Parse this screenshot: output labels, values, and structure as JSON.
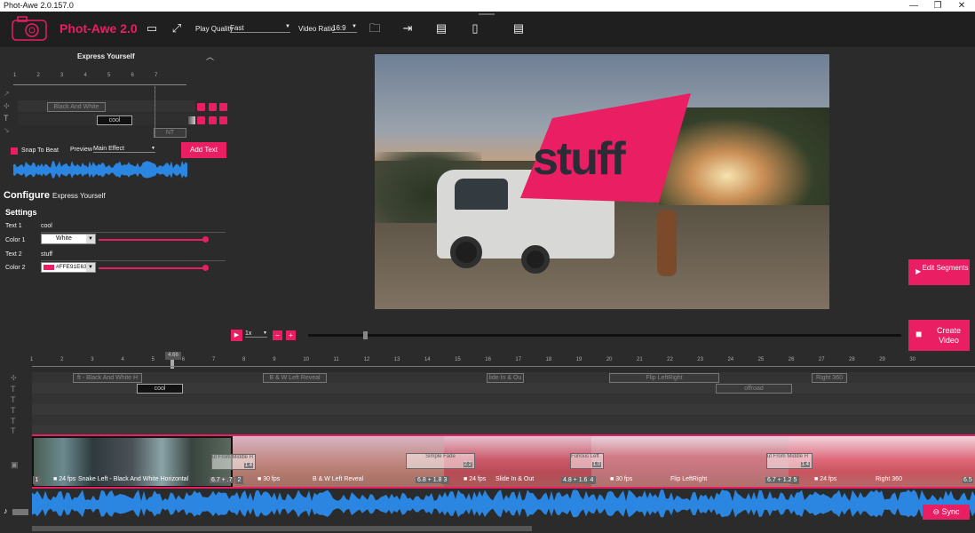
{
  "window": {
    "title": "Phot-Awe 2.0.157.0"
  },
  "header": {
    "app_name": "Phot-Awe 2.0",
    "play_quality_label": "Play Quality",
    "play_quality_value": "Fast",
    "video_ratio_label": "Video Ratio",
    "video_ratio_value": "16:9"
  },
  "effect_panel": {
    "title": "Express Yourself",
    "ruler": [
      "1",
      "2",
      "3",
      "4",
      "5",
      "6",
      "7"
    ],
    "tracks": [
      {
        "label": "Black And White"
      },
      {
        "label": "cool"
      },
      {
        "label": "NT"
      }
    ],
    "snap_label": "Snap To Beat",
    "preview_label": "Preview",
    "preview_value": "Main Effect",
    "add_text_label": "Add Text"
  },
  "configure": {
    "title": "Configure",
    "effect_name": "Express Yourself",
    "settings_title": "Settings",
    "text1_label": "Text 1",
    "text1_value": "cool",
    "color1_label": "Color 1",
    "color1_value": "White",
    "text2_label": "Text 2",
    "text2_value": "stuff",
    "color2_label": "Color 2",
    "color2_value": "#FFE91E63"
  },
  "preview": {
    "overlay_text": "stuff"
  },
  "right_buttons": {
    "edit_segments": "Edit Segments",
    "create_video": "Create Video"
  },
  "playback": {
    "speed": "1x"
  },
  "timeline": {
    "time_marker": "4.66",
    "ruler": [
      "1",
      "2",
      "3",
      "4",
      "5",
      "6",
      "7",
      "8",
      "9",
      "10",
      "11",
      "12",
      "13",
      "14",
      "15",
      "16",
      "17",
      "18",
      "19",
      "20",
      "21",
      "22",
      "23",
      "24",
      "25",
      "26",
      "27",
      "28",
      "29",
      "30"
    ],
    "effect_row1": [
      "ft - Black And White H",
      "B & W Left Reveal",
      "lide In & Ou",
      "Flip LeftRight",
      "Right 360"
    ],
    "effect_row2": [
      "cool",
      "offroad"
    ],
    "transitions": [
      {
        "name": "ut From Middle H",
        "dur": "1.4"
      },
      {
        "name": "Simple Fade",
        "dur": "2.2"
      },
      {
        "name": "Furious Left",
        "dur": "1.0"
      },
      {
        "name": "ut From Middle H",
        "dur": "1.4"
      }
    ],
    "clips": [
      {
        "num": "1",
        "fps": "24 fps",
        "effect": "Snake Left - Black And White Horizontal",
        "dur": "6.7 + .7"
      },
      {
        "num": "2",
        "fps": "30 fps",
        "effect": "B & W Left Reveal",
        "dur": "6.8 + 1.8"
      },
      {
        "num": "3",
        "fps": "24 fps",
        "effect": "Slide In & Out",
        "dur": "4.8 + 1.6"
      },
      {
        "num": "4",
        "fps": "30 fps",
        "effect": "Flip LeftRight",
        "dur": "6.7 + 1.2"
      },
      {
        "num": "5",
        "fps": "24 fps",
        "effect": "Right 360",
        "dur": "6.5"
      }
    ],
    "sync_label": "Sync"
  }
}
